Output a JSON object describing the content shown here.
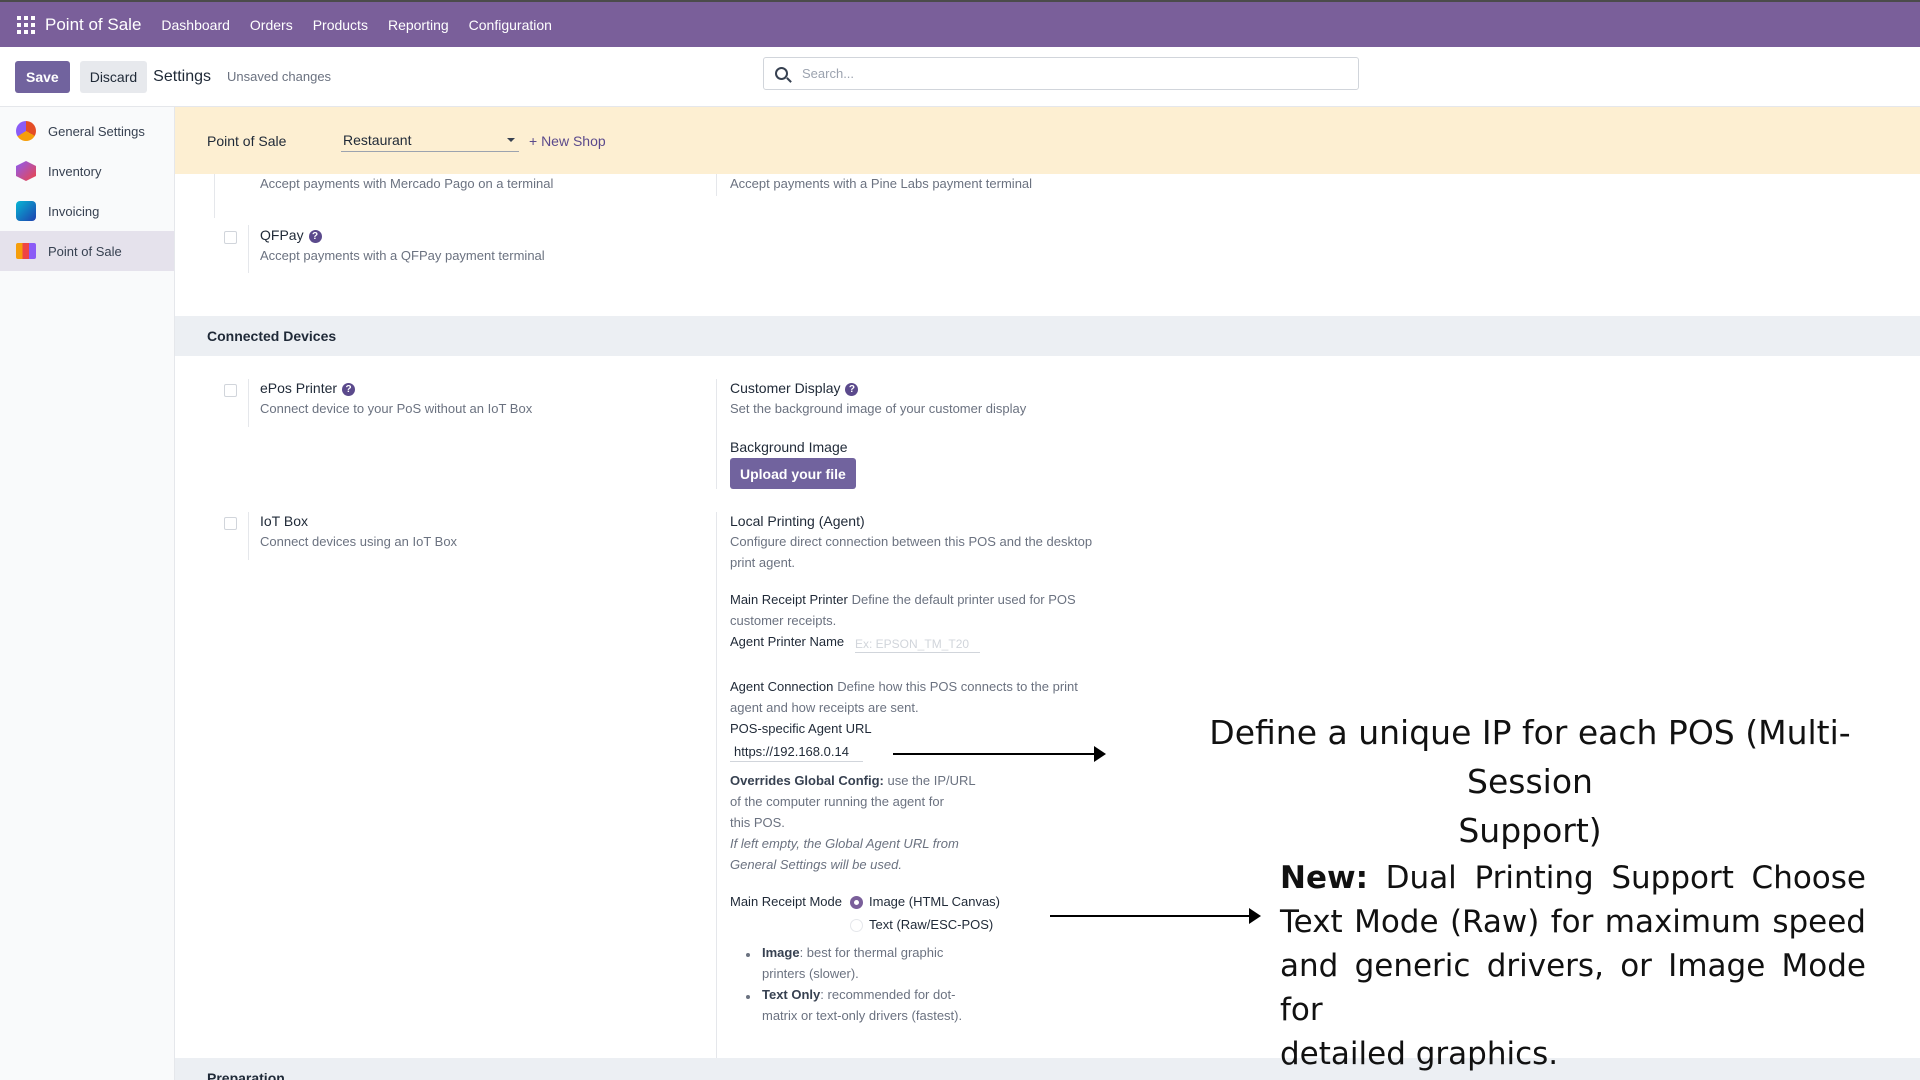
{
  "topbar": {
    "brand": "Point of Sale",
    "menu": [
      "Dashboard",
      "Orders",
      "Products",
      "Reporting",
      "Configuration"
    ]
  },
  "control": {
    "save": "Save",
    "discard": "Discard",
    "breadcrumb": "Settings",
    "status": "Unsaved changes",
    "search_placeholder": "Search..."
  },
  "sidebar": {
    "items": [
      "General Settings",
      "Inventory",
      "Invoicing",
      "Point of Sale"
    ],
    "active": "Point of Sale"
  },
  "shopbar": {
    "label": "Point of Sale",
    "selected_shop": "Restaurant",
    "new_shop": "+ New Shop"
  },
  "payments": {
    "mercado_desc": "Accept payments with Mercado Pago on a terminal",
    "pinelabs_desc": "Accept payments with a Pine Labs payment terminal",
    "qfpay_title": "QFPay",
    "qfpay_desc": "Accept payments with a QFPay payment terminal"
  },
  "connected_devices": {
    "title": "Connected Devices",
    "epos_title": "ePos Printer",
    "epos_desc": "Connect device to your PoS without an IoT Box",
    "iot_title": "IoT Box",
    "iot_desc": "Connect devices using an IoT Box",
    "display_title": "Customer Display",
    "display_desc": "Set the background image of your customer display",
    "bg_label": "Background Image",
    "upload": "Upload your file",
    "local_title": "Local Printing (Agent)",
    "local_desc1": "Configure direct connection between this POS and the desktop",
    "local_desc2": "print agent.",
    "main_printer_label": "Main Receipt Printer",
    "main_printer_desc1": "Define the default printer used for POS",
    "main_printer_desc2": "customer receipts.",
    "agent_name_label": "Agent Printer Name",
    "agent_name_placeholder": "Ex: EPSON_TM_T20",
    "conn_label": "Agent Connection",
    "conn_desc1": "Define how this POS connects to the print",
    "conn_desc2": "agent and how receipts are sent.",
    "url_label": "POS-specific Agent URL",
    "url_value": "https://192.168.0.14",
    "override_bold": "Overrides Global Config:",
    "override_1": "use the IP/URL",
    "override_2": "of the computer running the agent for",
    "override_3": "this POS.",
    "override_it1": "If left empty, the Global Agent URL from",
    "override_it2": "General Settings will be used.",
    "mode_label": "Main Receipt Mode",
    "mode_image": "Image (HTML Canvas)",
    "mode_text": "Text (Raw/ESC-POS)",
    "b1_bold": "Image",
    "b1_text": ": best for thermal graphic",
    "b1_text2": "printers (slower).",
    "b2_bold": "Text Only",
    "b2_text": ": recommended for dot-",
    "b2_text2": "matrix or text-only drivers (fastest)."
  },
  "preparation": {
    "title": "Preparation"
  },
  "annotations": {
    "a1_line1": "Define a unique IP for each POS (Multi-Session",
    "a1_line2": "Support)",
    "a2_bold": "New:",
    "a2_l1": "Dual Printing Support Choose",
    "a2_l2": "Text Mode (Raw) for maximum speed",
    "a2_l3": "and generic drivers, or Image Mode for",
    "a2_l4": "detailed graphics."
  }
}
